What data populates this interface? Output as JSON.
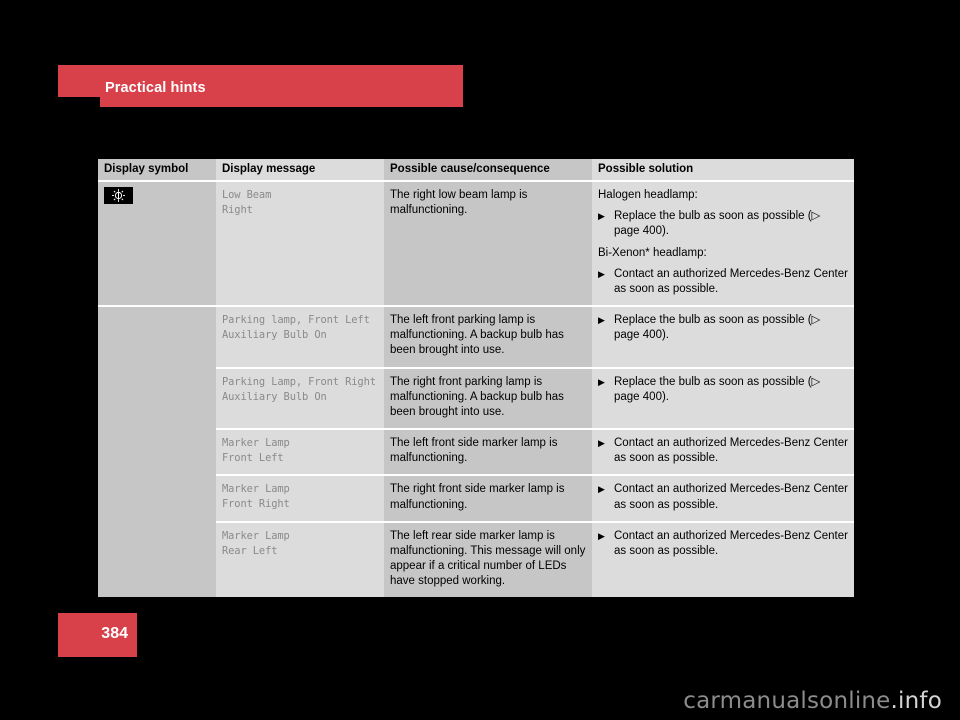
{
  "section": {
    "title": "Practical hints",
    "accent_color": "#d8404a"
  },
  "table": {
    "headers": {
      "symbol": "Display symbol",
      "message": "Display message",
      "cause": "Possible cause/consequence",
      "solution": "Possible solution"
    },
    "rows": [
      {
        "symbol_icon": "headlamp-low-beam-icon",
        "message": "Low Beam\nRight",
        "cause": "The right low beam lamp is malfunctioning.",
        "solution_blocks": [
          {
            "type": "lead",
            "text": "Halogen headlamp:"
          },
          {
            "type": "bullet",
            "text": "Replace the bulb as soon as possible (▷ page 400)."
          },
          {
            "type": "lead",
            "text": "Bi-Xenon* headlamp:"
          },
          {
            "type": "bullet",
            "text": "Contact an authorized Mercedes-Benz Center as soon as possible."
          }
        ]
      },
      {
        "symbol_icon": "",
        "message": "Parking lamp, Front Left\nAuxiliary Bulb On",
        "cause": "The left front parking lamp is malfunctioning. A backup bulb has been brought into use.",
        "solution_blocks": [
          {
            "type": "bullet",
            "text": "Replace the bulb as soon as possible (▷ page 400)."
          }
        ]
      },
      {
        "symbol_icon": "",
        "message": "Parking Lamp, Front Right\nAuxiliary Bulb On",
        "cause": "The right front parking lamp is malfunctioning. A backup bulb has been brought into use.",
        "solution_blocks": [
          {
            "type": "bullet",
            "text": "Replace the bulb as soon as possible (▷ page 400)."
          }
        ]
      },
      {
        "symbol_icon": "",
        "message": "Marker Lamp\nFront Left",
        "cause": "The left front side marker lamp is malfunctioning.",
        "solution_blocks": [
          {
            "type": "bullet",
            "text": "Contact an authorized Mercedes-Benz Center as soon as possible."
          }
        ]
      },
      {
        "symbol_icon": "",
        "message": "Marker Lamp\nFront Right",
        "cause": "The right front side marker lamp is malfunctioning.",
        "solution_blocks": [
          {
            "type": "bullet",
            "text": "Contact an authorized Mercedes-Benz Center as soon as possible."
          }
        ]
      },
      {
        "symbol_icon": "",
        "message": "Marker Lamp\nRear Left",
        "cause": "The left rear side marker lamp is malfunctioning. This message will only appear if a critical number of LEDs have stopped working.",
        "solution_blocks": [
          {
            "type": "bullet",
            "text": "Contact an authorized Mercedes-Benz Center as soon as possible."
          }
        ]
      }
    ]
  },
  "footer": {
    "page_number": "384",
    "watermark_main": "carmanualsonline",
    "watermark_tld": ".info"
  }
}
